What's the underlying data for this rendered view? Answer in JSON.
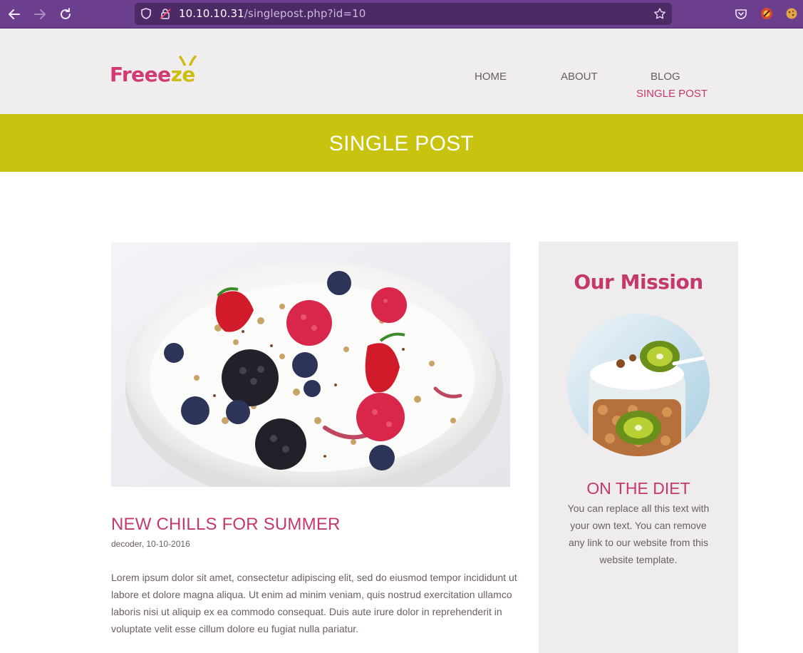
{
  "browser": {
    "url_host": "10.10.10.31",
    "url_path": "/singlepost.php?id=10"
  },
  "site": {
    "logo_main": "Freee",
    "logo_accent": "ze",
    "nav": [
      "HOME",
      "ABOUT",
      "BLOG",
      "SINGLE POST"
    ]
  },
  "banner": {
    "title": "SINGLE POST"
  },
  "post": {
    "title": "NEW CHILLS FOR SUMMER",
    "meta": "decoder, 10-10-2016",
    "body": "Lorem ipsum dolor sit amet, consectetur adipiscing elit, sed do eiusmod tempor incididunt ut labore et dolore magna aliqua. Ut enim ad minim veniam, quis nostrud exercitation ullamco laboris nisi ut aliquip ex ea commodo consequat. Duis aute irure dolor in reprehenderit in voluptate velit esse cillum dolore eu fugiat nulla pariatur."
  },
  "sidebar": {
    "heading": "Our Mission",
    "subheading": "ON THE DIET",
    "text": "You can replace all this text with your own text. You can remove any link to our website from this website template."
  },
  "colors": {
    "browser_chrome": "#6b3f8e",
    "accent_pink": "#c5386b",
    "banner_yellow": "#c8c30f",
    "header_bg": "#efeded"
  },
  "icons": [
    "back-arrow-icon",
    "forward-arrow-icon",
    "reload-icon",
    "shield-icon",
    "lock-icon",
    "bookmark-star-icon",
    "pocket-icon",
    "extension-icon",
    "cookie-icon"
  ]
}
